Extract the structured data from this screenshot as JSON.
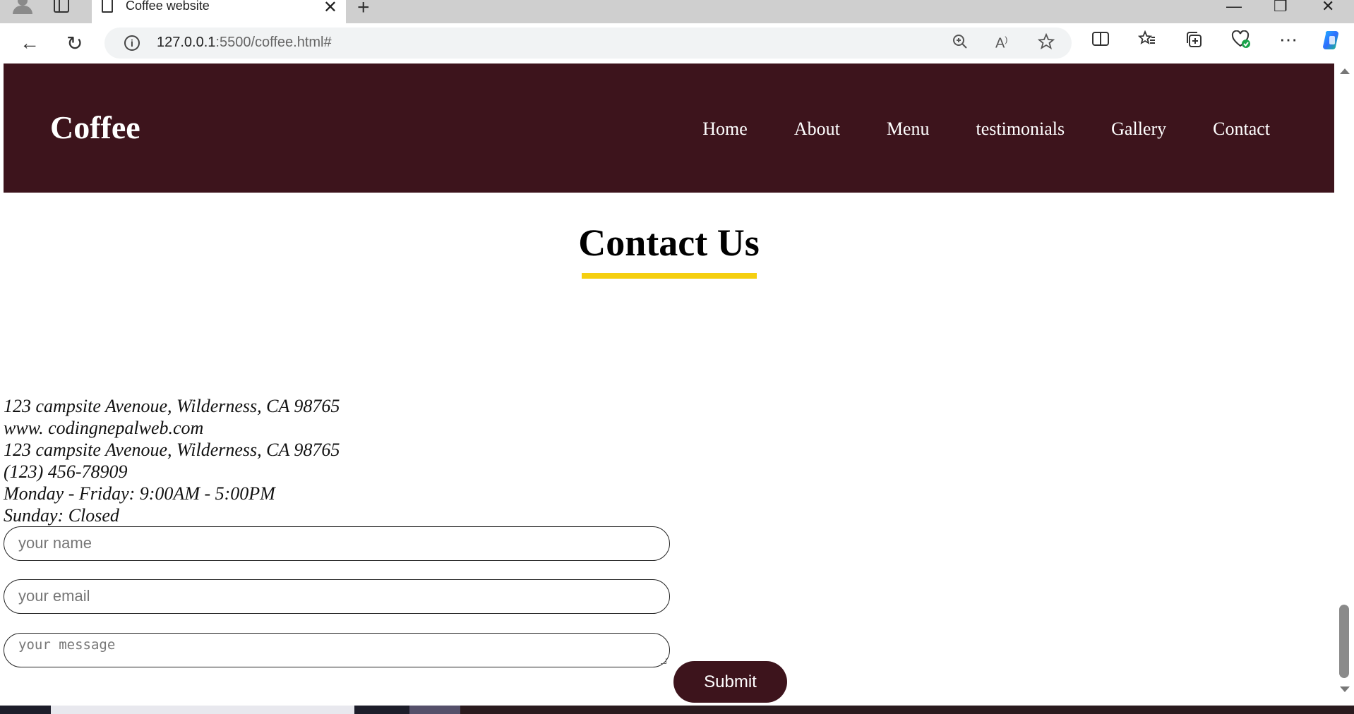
{
  "browser": {
    "tab_title": "Coffee website",
    "tab_close_glyph": "✕",
    "new_tab_glyph": "+",
    "url_host": "127.0.0.1",
    "url_rest": ":5500/coffee.html#",
    "window_controls": {
      "minimize": "—",
      "restore": "❐",
      "close": "✕"
    },
    "nav": {
      "back": "←",
      "refresh": "↻"
    },
    "icons": [
      "zoom-icon",
      "read-aloud-icon",
      "favorite-star-icon",
      "split-screen-icon",
      "favorites-icon",
      "collections-icon",
      "performance-icon",
      "more-icon",
      "copilot-icon"
    ]
  },
  "header": {
    "logo": "Coffee",
    "nav": [
      "Home",
      "About",
      "Menu",
      "testimonials",
      "Gallery",
      "Contact"
    ],
    "bg_color": "#3d141c"
  },
  "contact": {
    "title": "Contact Us",
    "underline_color": "#f5cf10",
    "lines": [
      "123 campsite Avenoue, Wilderness, CA 98765",
      "www. codingnepalweb.com",
      "123 campsite Avenoue, Wilderness, CA 98765",
      "(123) 456-78909",
      "Monday - Friday: 9:00AM - 5:00PM",
      "Sunday: Closed"
    ],
    "form": {
      "name_placeholder": "your name",
      "email_placeholder": "your email",
      "message_placeholder": "your message",
      "submit_label": "Submit"
    }
  }
}
